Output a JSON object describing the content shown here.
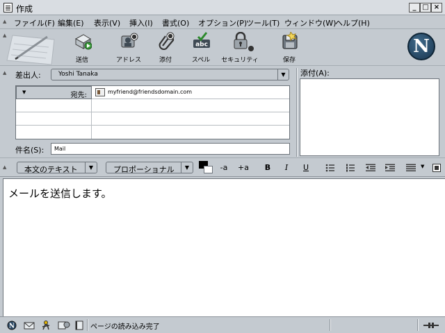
{
  "window": {
    "title": "作成",
    "minimize": "_",
    "maximize": "□",
    "close": "×"
  },
  "menu": [
    "ファイル(F)",
    "編集(E)",
    "表示(V)",
    "挿入(I)",
    "書式(O)",
    "オプション(P)",
    "ツール(T)",
    "ウィンドウ(W)",
    "ヘルプ(H)"
  ],
  "toolbar": {
    "send": "送信",
    "address": "アドレス",
    "attach": "添付",
    "spell": "スペル",
    "security": "セキュリティ",
    "save": "保存",
    "spell_icon_text": "abc"
  },
  "compose": {
    "from_label": "差出人:",
    "from_value": "Yoshi Tanaka",
    "recipients": [
      {
        "type": "宛先:",
        "address": "myfriend@friendsdomain.com"
      }
    ],
    "subject_label": "件名(S):",
    "subject_value": "Mail",
    "attach_label": "添付(A):"
  },
  "format": {
    "paragraph_style": "本文のテキスト",
    "font": "プロポーショナル",
    "smaller": "-a",
    "larger": "+a",
    "bold": "B",
    "italic": "I",
    "underline": "U"
  },
  "body": {
    "text": "メールを送信します。"
  },
  "status": {
    "text": "ページの読み込み完了"
  },
  "colors": {
    "chrome": "#c4cad0",
    "logo": "#1a3650"
  }
}
